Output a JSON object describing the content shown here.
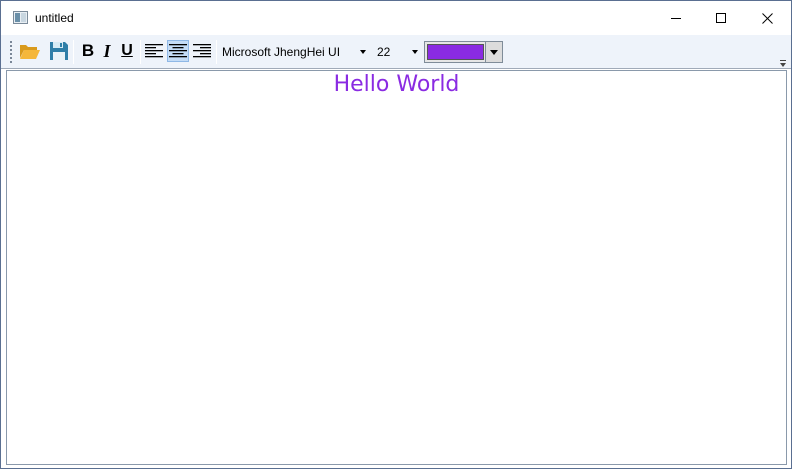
{
  "window": {
    "title": "untitled",
    "app_icon": "window-app-icon",
    "controls": [
      "minimize-icon",
      "maximize-icon",
      "close-icon"
    ]
  },
  "toolbar": {
    "open_icon": "folder-open-icon",
    "save_icon": "floppy-disk-icon",
    "bold_label": "B",
    "italic_label": "I",
    "underline_label": "U",
    "align_buttons": [
      {
        "icon": "align-left-icon",
        "active": false
      },
      {
        "icon": "align-center-icon",
        "active": true
      },
      {
        "icon": "align-right-icon",
        "active": false
      }
    ],
    "font_family": "Microsoft JhengHei UI",
    "font_size": "22",
    "text_color": "#8a2be2",
    "overflow_icon": "toolbar-overflow-chevron-icon"
  },
  "document": {
    "text": "Hello World",
    "text_color": "#8a2be2",
    "alignment": "center"
  }
}
